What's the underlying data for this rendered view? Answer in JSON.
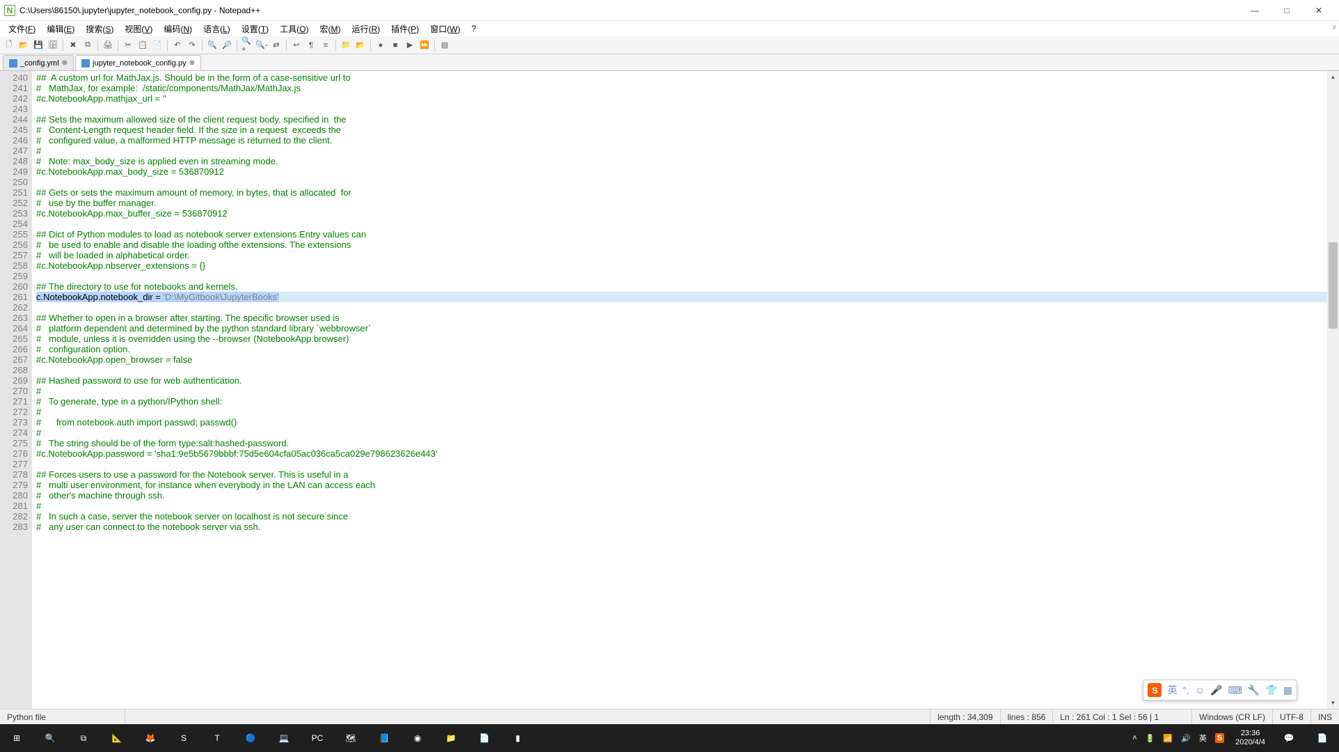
{
  "title": "C:\\Users\\86150\\.jupyter\\jupyter_notebook_config.py - Notepad++",
  "menus": [
    {
      "label": "文件",
      "accel": "F"
    },
    {
      "label": "编辑",
      "accel": "E"
    },
    {
      "label": "搜索",
      "accel": "S"
    },
    {
      "label": "视图",
      "accel": "V"
    },
    {
      "label": "编码",
      "accel": "N"
    },
    {
      "label": "语言",
      "accel": "L"
    },
    {
      "label": "设置",
      "accel": "T"
    },
    {
      "label": "工具",
      "accel": "O"
    },
    {
      "label": "宏",
      "accel": "M"
    },
    {
      "label": "运行",
      "accel": "R"
    },
    {
      "label": "插件",
      "accel": "P"
    },
    {
      "label": "窗口",
      "accel": "W"
    },
    {
      "label": "?",
      "accel": ""
    }
  ],
  "toolbar_icons": [
    "new-file",
    "open-file",
    "save",
    "save-all",
    "|",
    "close",
    "close-all",
    "|",
    "print",
    "|",
    "cut",
    "copy",
    "paste",
    "|",
    "undo",
    "redo",
    "|",
    "find",
    "replace",
    "|",
    "zoom-in",
    "zoom-out",
    "sync",
    "|",
    "word-wrap",
    "show-all",
    "indent-guide",
    "|",
    "folder",
    "folder-open",
    "|",
    "record",
    "stop",
    "play",
    "fast-forward",
    "|",
    "panel"
  ],
  "tabs": [
    {
      "name": "_config.yml",
      "modified": true,
      "active": false
    },
    {
      "name": "jupyter_notebook_config.py",
      "modified": true,
      "active": true
    }
  ],
  "first_line": 240,
  "highlight_line": 261,
  "lines": [
    "##  A custom url for MathJax.js. Should be in the form of a case-sensitive url to",
    "#   MathJax, for example:  /static/components/MathJax/MathJax.js",
    "#c.NotebookApp.mathjax_url = ''",
    "",
    "## Sets the maximum allowed size of the client request body, specified in  the",
    "#   Content-Length request header field. If the size in a request  exceeds the",
    "#   configured value, a malformed HTTP message is returned to the client.",
    "#",
    "#   Note: max_body_size is applied even in streaming mode.",
    "#c.NotebookApp.max_body_size = 536870912",
    "",
    "## Gets or sets the maximum amount of memory, in bytes, that is allocated  for",
    "#   use by the buffer manager.",
    "#c.NotebookApp.max_buffer_size = 536870912",
    "",
    "## Dict of Python modules to load as notebook server extensions.Entry values can",
    "#   be used to enable and disable the loading ofthe extensions. The extensions",
    "#   will be loaded in alphabetical order.",
    "#c.NotebookApp.nbserver_extensions = {}",
    "",
    "## The directory to use for notebooks and kernels.",
    {
      "selected": true,
      "code": "c.NotebookApp.notebook_dir = ",
      "str": "'D:\\MyGitbook\\JupyterBooks'"
    },
    "",
    "## Whether to open in a browser after starting. The specific browser used is",
    "#   platform dependent and determined by the python standard library `webbrowser`",
    "#   module, unless it is overridden using the --browser (NotebookApp.browser)",
    "#   configuration option.",
    "#c.NotebookApp.open_browser = false",
    "",
    "## Hashed password to use for web authentication.",
    "#",
    "#   To generate, type in a python/IPython shell:",
    "#",
    "#      from notebook.auth import passwd; passwd()",
    "#",
    "#   The string should be of the form type:salt:hashed-password.",
    "#c.NotebookApp.password = 'sha1:9e5b5679bbbf:75d5e604cfa05ac036ca5ca029e798623626e443'",
    "",
    "## Forces users to use a password for the Notebook server. This is useful in a",
    "#   multi user environment, for instance when everybody in the LAN can access each",
    "#   other's machine through ssh.",
    "#",
    "#   In such a case, server the notebook server on localhost is not secure since",
    "#   any user can connect to the notebook server via ssh."
  ],
  "status": {
    "filetype": "Python file",
    "length": "length : 34,309",
    "lines": "lines : 856",
    "pos": "Ln : 261   Col : 1   Sel : 56 | 1",
    "eol": "Windows (CR LF)",
    "encoding": "UTF-8",
    "mode": "INS"
  },
  "ime": {
    "lang": "英"
  },
  "taskbar": {
    "apps": [
      "start",
      "search",
      "task-view",
      "matlab",
      "gimp",
      "snagit",
      "texstudio",
      "teamviewer",
      "laptop",
      "pycharm",
      "map",
      "notepad",
      "chrome",
      "file-explorer",
      "text-editor",
      "terminal"
    ],
    "tray": [
      "chevron-up",
      "battery",
      "wifi",
      "volume",
      "ime-lang",
      "sogou"
    ],
    "tray_lang": "英",
    "time": "23:36",
    "date": "2020/4/4"
  },
  "colors": {
    "comment": "#008000",
    "string": "#808080",
    "highlight": "#d7e8f8",
    "selection": "#b5d5ff"
  }
}
